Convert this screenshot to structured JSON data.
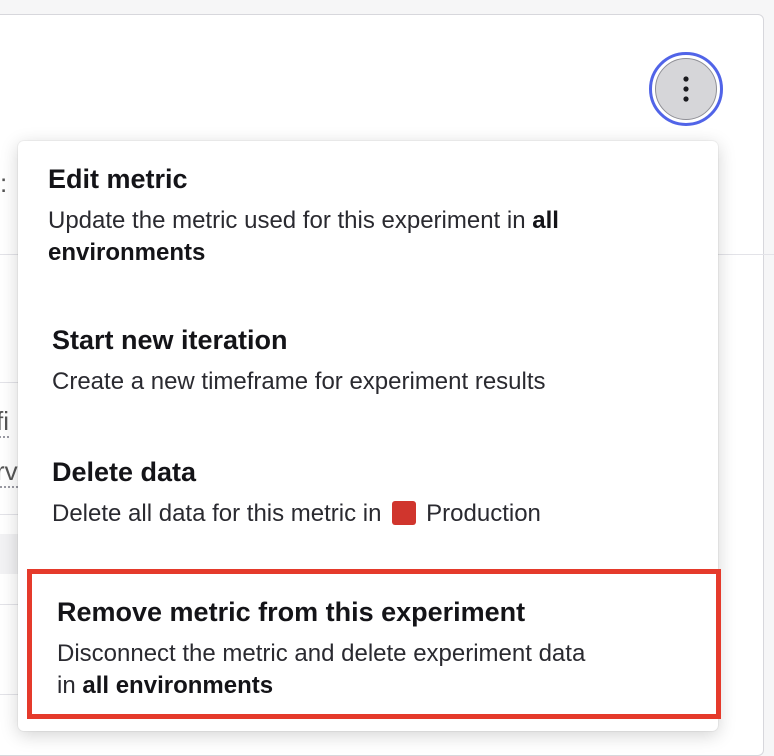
{
  "background": {
    "fragment_colon": ":",
    "fragment_fi": "fi",
    "fragment_rv": "rv"
  },
  "more_button": {
    "icon": "more-vertical-icon",
    "focused_ring_color": "#5164e8"
  },
  "menu": {
    "items": [
      {
        "title": "Edit metric",
        "description_prefix": "Update the metric used for this experiment in ",
        "description_bold": "all environments"
      },
      {
        "title": "Start new iteration",
        "description": "Create a new timeframe for experiment results"
      },
      {
        "title": "Delete data",
        "description_prefix": "Delete all data for this metric in",
        "environment": "Production",
        "environment_color": "#d0352d"
      },
      {
        "title": "Remove metric from this experiment",
        "description_line1": "Disconnect the metric and delete experiment data",
        "description_prefix": "in ",
        "description_bold": "all environments",
        "highlight_color": "#e53a2b"
      }
    ]
  }
}
